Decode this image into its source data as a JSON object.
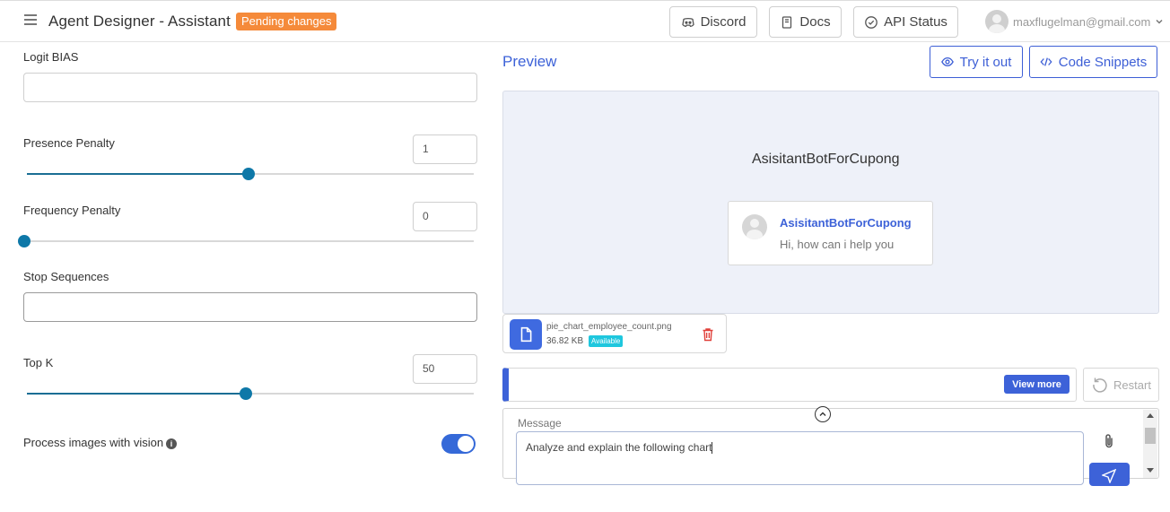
{
  "header": {
    "title": "Agent Designer - Assistant",
    "badge": "Pending changes",
    "discord_label": "Discord",
    "docs_label": "Docs",
    "api_status_label": "API Status",
    "user_email": "maxflugelman@gmail.com"
  },
  "settings": {
    "logit_bias": {
      "label": "Logit BIAS",
      "value": ""
    },
    "presence_penalty": {
      "label": "Presence Penalty",
      "value": "1",
      "slider_fraction": 0.496
    },
    "frequency_penalty": {
      "label": "Frequency Penalty",
      "value": "0",
      "slider_fraction": 0.0
    },
    "stop_sequences": {
      "label": "Stop Sequences",
      "value": ""
    },
    "top_k": {
      "label": "Top K",
      "value": "50",
      "slider_fraction": 0.49
    },
    "vision": {
      "label": "Process images with vision",
      "enabled": true
    }
  },
  "preview": {
    "title": "Preview",
    "try_label": "Try it out",
    "snippets_label": "Code Snippets",
    "bot_name": "AsisitantBotForCupong",
    "card_name": "AsisitantBotForCupong",
    "greeting": "Hi, how can i help you",
    "file": {
      "name": "pie_chart_employee_count.png",
      "size": "36.82 KB",
      "status": "Available"
    },
    "view_more_label": "View more",
    "restart_label": "Restart",
    "message_label": "Message",
    "message_value": "Analyze and explain the following chart"
  },
  "colors": {
    "accent": "#3d62d8",
    "badge": "#f58a3a",
    "slider": "#0e78a8",
    "available": "#1fc7de"
  }
}
